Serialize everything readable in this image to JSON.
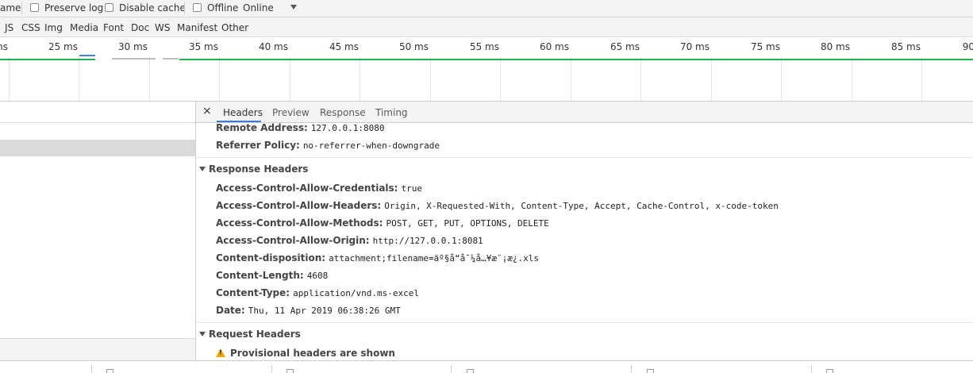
{
  "toolbar": {
    "name_fragment": "ame",
    "preserve_log": "Preserve log",
    "disable_cache": "Disable cache",
    "offline": "Offline",
    "throttle_selected": "Online"
  },
  "filters": [
    "JS",
    "CSS",
    "Img",
    "Media",
    "Font",
    "Doc",
    "WS",
    "Manifest",
    "Other"
  ],
  "timeline": {
    "ticks": [
      "ms",
      "25 ms",
      "30 ms",
      "35 ms",
      "40 ms",
      "45 ms",
      "50 ms",
      "55 ms",
      "60 ms",
      "65 ms",
      "70 ms",
      "75 ms",
      "80 ms",
      "85 ms",
      "90"
    ]
  },
  "detail": {
    "tabs": [
      "Headers",
      "Preview",
      "Response",
      "Timing"
    ],
    "active_tab": "Headers",
    "general": [
      {
        "key": "Remote Address:",
        "value": "127.0.0.1:8080"
      },
      {
        "key": "Referrer Policy:",
        "value": "no-referrer-when-downgrade"
      }
    ],
    "response_headers_title": "Response Headers",
    "response_headers": [
      {
        "key": "Access-Control-Allow-Credentials:",
        "value": "true"
      },
      {
        "key": "Access-Control-Allow-Headers:",
        "value": "Origin, X-Requested-With, Content-Type, Accept, Cache-Control, x-code-token"
      },
      {
        "key": "Access-Control-Allow-Methods:",
        "value": "POST, GET, PUT, OPTIONS, DELETE"
      },
      {
        "key": "Access-Control-Allow-Origin:",
        "value": "http://127.0.0.1:8081"
      },
      {
        "key": "Content-disposition:",
        "value": "attachment;filename=äº§å“å¯¼å…¥æ¨¡æ¿.xls"
      },
      {
        "key": "Content-Length:",
        "value": "4608"
      },
      {
        "key": "Content-Type:",
        "value": "application/vnd.ms-excel"
      },
      {
        "key": "Date:",
        "value": "Thu, 11 Apr 2019 06:38:26 GMT"
      }
    ],
    "request_headers_title": "Request Headers",
    "provisional_warning": "Provisional headers are shown"
  },
  "colors": {
    "accent_blue": "#3879d9",
    "timeline_green": "#21b24b",
    "warning_amber": "#f2a600"
  }
}
